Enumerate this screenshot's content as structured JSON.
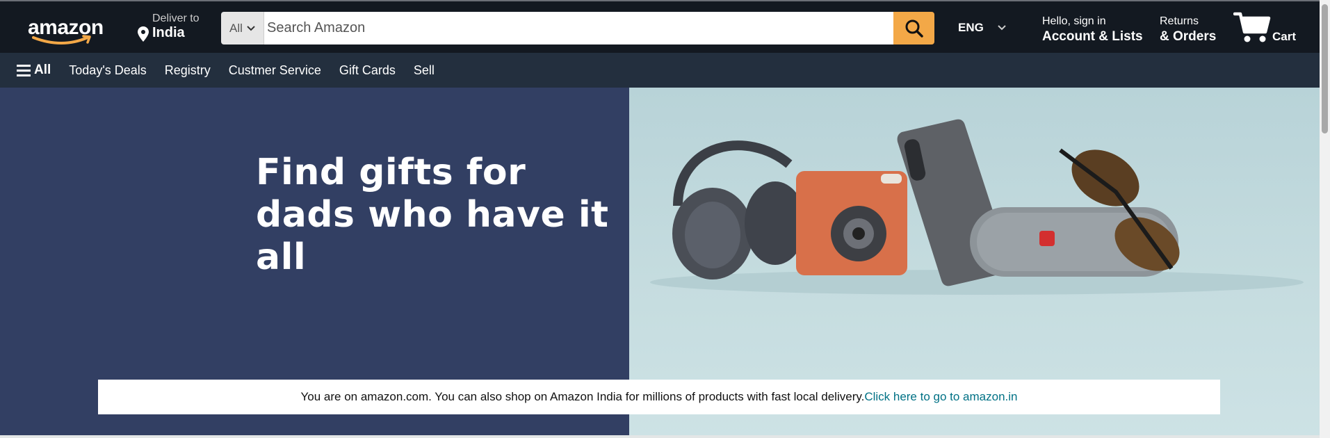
{
  "header": {
    "logo_text": "amazon",
    "deliver": {
      "label": "Deliver to",
      "location": "India"
    },
    "search": {
      "category": "All",
      "placeholder": "Search Amazon"
    },
    "language": "ENG",
    "account": {
      "greeting": "Hello, sign in",
      "label": "Account & Lists"
    },
    "returns": {
      "top": "Returns",
      "bottom": "& Orders"
    },
    "cart": {
      "label": "Cart"
    }
  },
  "nav": {
    "all_label": "All",
    "items": [
      "Today's Deals",
      "Registry",
      "Custmer Service",
      "Gift Cards",
      "Sell"
    ]
  },
  "hero": {
    "headline_line1": "Find gifts for",
    "headline_line2": "dads who have it all"
  },
  "notice": {
    "text": "You are on amazon.com. You can also shop on Amazon India for millions of products with fast local delivery.",
    "link": "Click here to go to amazon.in"
  },
  "colors": {
    "header_bg": "#131921",
    "nav_bg": "#232f3e",
    "search_button": "#f3a847",
    "hero_left_bg": "#323f63",
    "link": "#007185"
  },
  "icons": [
    "map-pin-icon",
    "search-icon",
    "chevron-down-icon",
    "hamburger-icon",
    "cart-icon"
  ]
}
